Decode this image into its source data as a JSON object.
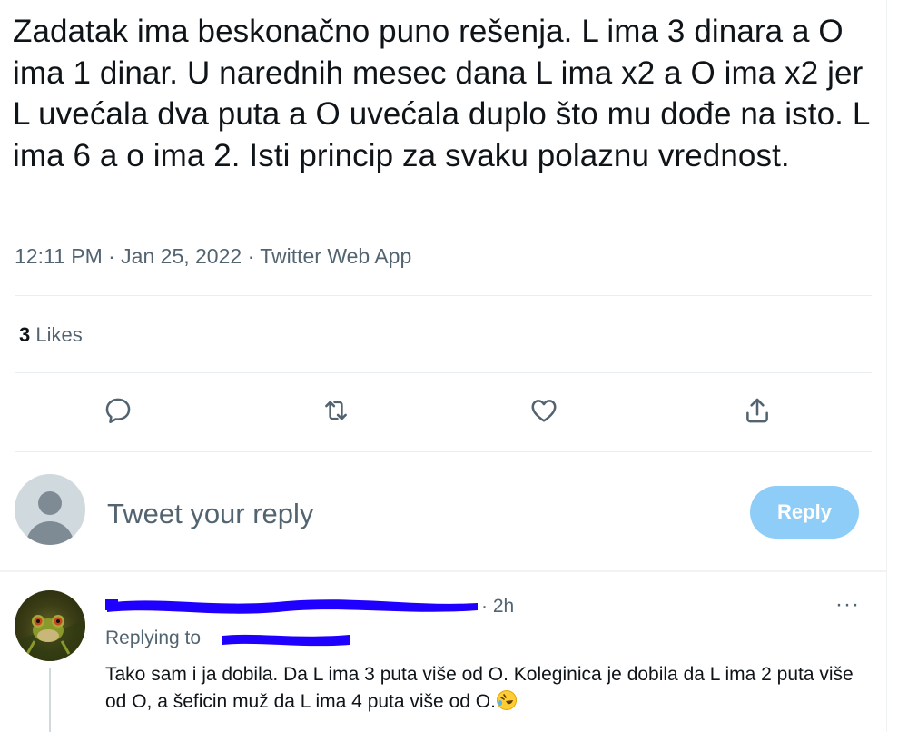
{
  "tweet": {
    "text": "Zadatak ima beskonačno puno rešenja. L ima 3 dinara a O ima 1 dinar. U narednih mesec dana L ima x2 a O ima x2 jer L uvećala dva puta a O uvećala duplo što mu dođe na isto. L ima 6 a o ima 2. Isti princip za svaku polaznu vrednost.",
    "timestamp": "12:11 PM · Jan 25, 2022 · Twitter Web App",
    "likes_count": "3",
    "likes_label": " Likes"
  },
  "actions": {
    "reply_icon": "comment-icon",
    "retweet_icon": "retweet-icon",
    "like_icon": "heart-icon",
    "share_icon": "share-icon"
  },
  "composer": {
    "placeholder": "Tweet your reply",
    "button_label": "Reply"
  },
  "comment": {
    "time": "· 2h",
    "more": "···",
    "replying_to": "Replying to",
    "text": "Tako sam i ja dobila. Da L ima 3 puta više od O. Koleginica je dobila da L ima 2 puta više od O, a šeficin muž da L ima 4 puta više od O."
  },
  "colors": {
    "secondary_text": "#536471",
    "reply_button": "#8ecdf8",
    "redaction": "#1f00ff"
  }
}
